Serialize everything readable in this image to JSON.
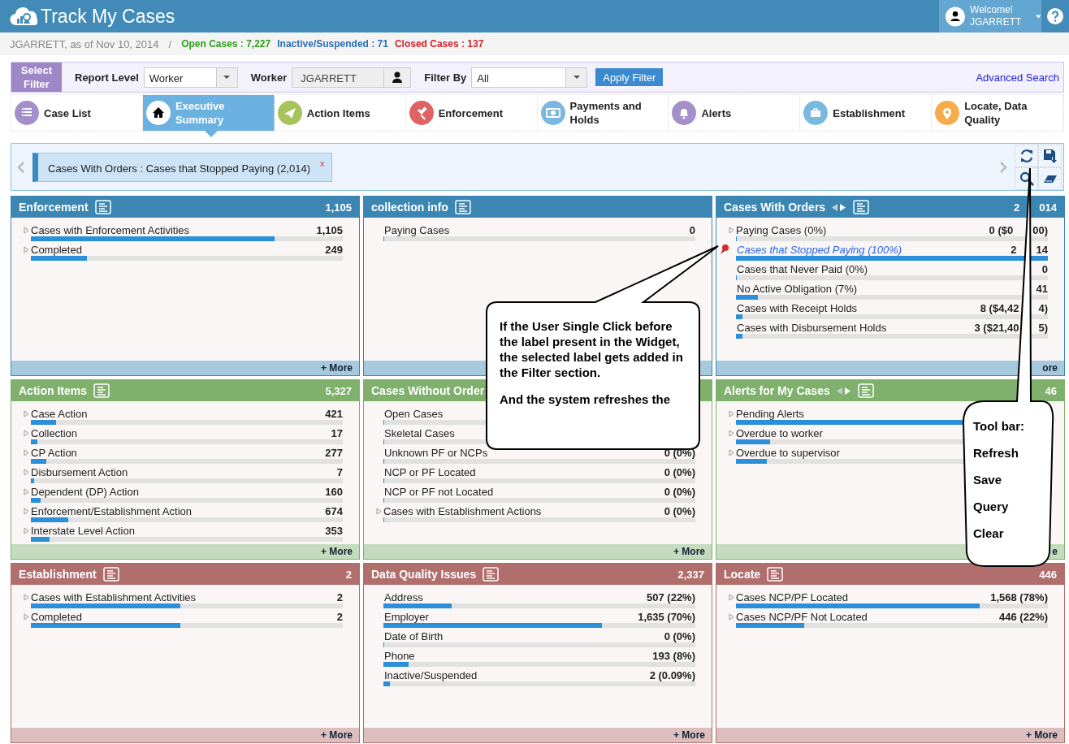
{
  "app": {
    "title": "Track My Cases"
  },
  "user": {
    "greeting": "Welcome!",
    "name": "JGARRETT"
  },
  "summary": {
    "as_of": "JGARRETT, as of Nov 10, 2014",
    "separator": "/",
    "stats": [
      {
        "label": "Open Cases : 7,227",
        "color": "#2f9e1c"
      },
      {
        "label": "Inactive/Suspended : 71",
        "color": "#2a6fb6"
      },
      {
        "label": "Closed Cases : 137",
        "color": "#d2232a"
      }
    ]
  },
  "filter_bar": {
    "button": "Select Filter",
    "report_level": {
      "label": "Report Level",
      "value": "Worker"
    },
    "worker": {
      "label": "Worker",
      "value": "JGARRETT"
    },
    "filter_by": {
      "label": "Filter By",
      "value": "All"
    },
    "apply": "Apply Filter",
    "advanced": "Advanced Search"
  },
  "tabs": [
    {
      "label": "Case List",
      "kind": "list",
      "color": "#a58fcb",
      "selected": false
    },
    {
      "label": "Executive Summary",
      "kind": "home",
      "color": "#ffffff",
      "selected": true
    },
    {
      "label": "Action Items",
      "kind": "plane",
      "color": "#a8c35a",
      "selected": false
    },
    {
      "label": "Enforcement",
      "kind": "gavel",
      "color": "#e06363",
      "selected": false
    },
    {
      "label": "Payments and Holds",
      "kind": "money",
      "color": "#7ab8e0",
      "selected": false
    },
    {
      "label": "Alerts",
      "kind": "bell",
      "color": "#a58fcb",
      "selected": false
    },
    {
      "label": "Establishment",
      "kind": "briefcase",
      "color": "#7ab8e0",
      "selected": false
    },
    {
      "label": "Locate, Data Quality",
      "kind": "pin",
      "color": "#f7ac4b",
      "selected": false
    }
  ],
  "active_filters": [
    {
      "text": "Cases With Orders : Cases that Stopped Paying (2,014)",
      "remove": "x"
    }
  ],
  "widgets": [
    {
      "title": "Enforcement",
      "count": "1,105",
      "color": "#3c86b3",
      "nav_arrows": false,
      "more": "+ More",
      "rows": [
        {
          "label": "Cases with Enforcement Activities",
          "value": "1,105",
          "level": 0.78,
          "expandable": true,
          "selected": false
        },
        {
          "label": "Completed",
          "value": "249",
          "level": 0.18,
          "expandable": true,
          "selected": false
        }
      ]
    },
    {
      "title": "collection info",
      "color": "#3c86b3",
      "nav_arrows": false,
      "rows": [
        {
          "label": "Paying Cases",
          "value": "0",
          "level": 0,
          "expandable": false,
          "selected": false
        }
      ]
    },
    {
      "title": "Cases With Orders",
      "count": "2",
      "count_tail": "014",
      "color": "#3c86b3",
      "nav_arrows": true,
      "more": "ore",
      "rows": [
        {
          "label": "Paying Cases (0%)",
          "value": "0 ($0",
          "value_tail": "00)",
          "level": 0,
          "expandable": true,
          "selected": false
        },
        {
          "label": "Cases that Stopped Paying (100%)",
          "value": "2",
          "value_tail": "14",
          "level": 1,
          "expandable": false,
          "selected": true
        },
        {
          "label": "Cases that Never Paid (0%)",
          "value": "0",
          "level": 0,
          "expandable": false,
          "selected": false
        },
        {
          "label": "No Active Obligation (7%)",
          "value": "41",
          "level": 0.07,
          "expandable": false,
          "selected": false
        },
        {
          "label": "Cases with Receipt Holds",
          "value": "8 ($4,42",
          "value_tail": "4)",
          "level": 0.02,
          "expandable": false,
          "selected": false
        },
        {
          "label": "Cases with Disbursement Holds",
          "value": "3 ($21,40",
          "value_tail": "5)",
          "level": 0.02,
          "expandable": false,
          "selected": false
        }
      ]
    },
    {
      "title": "Action Items",
      "count": "5,327",
      "color": "#7fb06c",
      "nav_arrows": false,
      "more": "+ More",
      "rows": [
        {
          "label": "Case Action",
          "value": "421",
          "level": 0.08,
          "expandable": true,
          "selected": false
        },
        {
          "label": "Collection",
          "value": "17",
          "level": 0.02,
          "expandable": true,
          "selected": false
        },
        {
          "label": "CP Action",
          "value": "277",
          "level": 0.05,
          "expandable": true,
          "selected": false
        },
        {
          "label": "Disbursement Action",
          "value": "7",
          "level": 0.01,
          "expandable": true,
          "selected": false
        },
        {
          "label": "Dependent (DP) Action",
          "value": "160",
          "level": 0.03,
          "expandable": true,
          "selected": false
        },
        {
          "label": "Enforcement/Establishment Action",
          "value": "674",
          "level": 0.12,
          "expandable": true,
          "selected": false
        },
        {
          "label": "Interstate Level Action",
          "value": "353",
          "level": 0.06,
          "expandable": true,
          "selected": false
        }
      ]
    },
    {
      "title": "Cases Without Order",
      "color": "#7fb06c",
      "nav_arrows": false,
      "more": "+ More",
      "rows": [
        {
          "label": "Open Cases",
          "level": 0,
          "expandable": false,
          "selected": false
        },
        {
          "label": "Skeletal Cases",
          "level": 0,
          "expandable": false,
          "selected": false
        },
        {
          "label": "Unknown PF or NCPs",
          "value": "0 (0%)",
          "level": 0,
          "expandable": false,
          "selected": false
        },
        {
          "label": "NCP or PF Located",
          "value": "0 (0%)",
          "level": 0,
          "expandable": false,
          "selected": false
        },
        {
          "label": "NCP or PF not Located",
          "value": "0 (0%)",
          "level": 0,
          "expandable": false,
          "selected": false
        },
        {
          "label": "Cases with Establishment Actions",
          "value": "0 (0%)",
          "level": 0,
          "expandable": true,
          "selected": false
        }
      ]
    },
    {
      "title": "Alerts for My Cases",
      "count": "46",
      "color": "#7fb06c",
      "nav_arrows": true,
      "more": "e",
      "rows": [
        {
          "label": "Pending Alerts",
          "level": 0.9,
          "expandable": true,
          "selected": false
        },
        {
          "label": "Overdue to worker",
          "level": 0.11,
          "expandable": true,
          "selected": false
        },
        {
          "label": "Overdue to supervisor",
          "level": 0.1,
          "expandable": true,
          "selected": false
        }
      ]
    },
    {
      "title": "Establishment",
      "count": "2",
      "color": "#b06e6c",
      "nav_arrows": false,
      "more": "+ More",
      "rows": [
        {
          "label": "Cases with Establishment Activities",
          "value": "2",
          "level": 0.48,
          "expandable": true,
          "selected": false
        },
        {
          "label": "Completed",
          "value": "2",
          "level": 0.48,
          "expandable": true,
          "selected": false
        }
      ]
    },
    {
      "title": "Data Quality Issues",
      "count": "2,337",
      "color": "#b06e6c",
      "nav_arrows": false,
      "more": "+ More",
      "rows": [
        {
          "label": "Address",
          "value": "507 (22%)",
          "level": 0.22,
          "expandable": false,
          "selected": false
        },
        {
          "label": "Employer",
          "value": "1,635 (70%)",
          "level": 0.7,
          "expandable": false,
          "selected": false
        },
        {
          "label": "Date of Birth",
          "value": "0 (0%)",
          "level": 0,
          "expandable": false,
          "selected": false
        },
        {
          "label": "Phone",
          "value": "193 (8%)",
          "level": 0.08,
          "expandable": false,
          "selected": false
        },
        {
          "label": "Inactive/Suspended",
          "value": "2 (0.09%)",
          "level": 0.02,
          "expandable": false,
          "selected": false
        }
      ]
    },
    {
      "title": "Locate",
      "count": "446",
      "color": "#b06e6c",
      "nav_arrows": false,
      "more": "+ More",
      "rows": [
        {
          "label": "Cases NCP/PF Located",
          "value": "1,568 (78%)",
          "level": 0.78,
          "expandable": true,
          "selected": false
        },
        {
          "label": "Cases NCP/PF Not Located",
          "value": "446 (22%)",
          "level": 0.22,
          "expandable": true,
          "selected": false
        }
      ]
    }
  ],
  "callouts": [
    {
      "kind": "wide",
      "lines": [
        "If the User Single Click before the label present in the Widget, the selected label gets added in the Filter section.",
        "And the system refreshes the"
      ]
    },
    {
      "kind": "tall",
      "lines": [
        "Tool bar:",
        "Refresh",
        "Save",
        "Query",
        "Clear"
      ]
    }
  ]
}
